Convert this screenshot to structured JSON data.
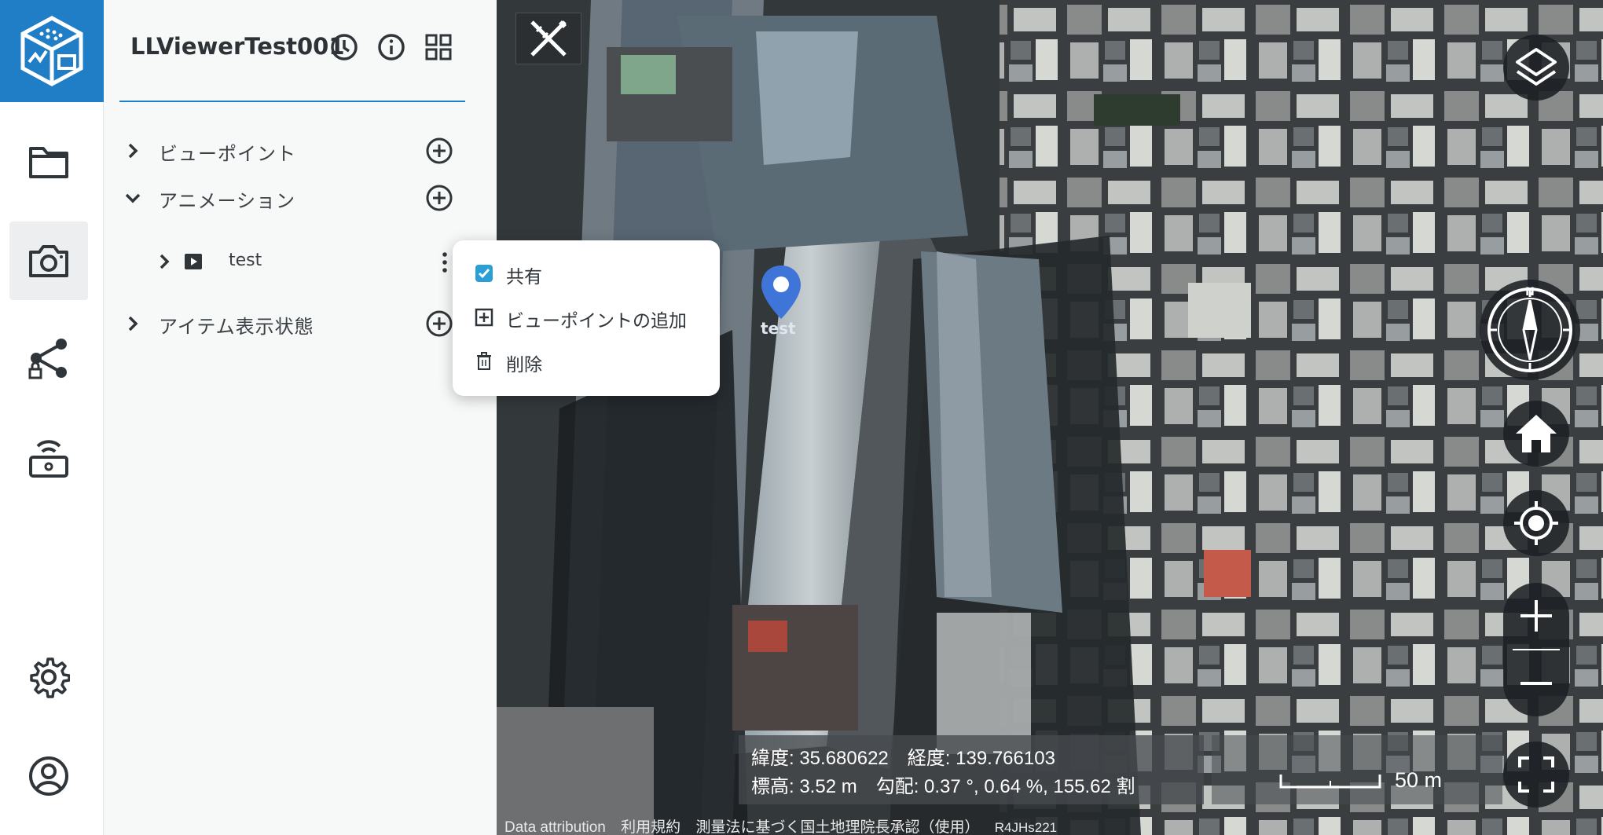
{
  "project": {
    "title": "LLViewerTest001"
  },
  "rail": {
    "items": [
      {
        "name": "folder",
        "icon": "folder-icon"
      },
      {
        "name": "camera",
        "icon": "camera-icon",
        "active": true
      },
      {
        "name": "share",
        "icon": "share-lock-icon"
      },
      {
        "name": "broadcast",
        "icon": "broadcast-icon"
      },
      {
        "name": "settings",
        "icon": "gear-icon"
      },
      {
        "name": "account",
        "icon": "user-circle-icon"
      }
    ]
  },
  "tree": {
    "sections": [
      {
        "label": "ビューポイント",
        "expanded": false
      },
      {
        "label": "アニメーション",
        "expanded": true
      },
      {
        "label": "アイテム表示状態",
        "expanded": false
      }
    ],
    "animation_items": [
      {
        "label": "test"
      }
    ]
  },
  "context_menu": {
    "share_label": "共有",
    "share_checked": true,
    "add_viewpoint_label": "ビューポイントの追加",
    "delete_label": "削除"
  },
  "map": {
    "pin_label": "test",
    "coords_line1": "緯度: 35.680622　経度: 139.766103",
    "coords_line2": "標高: 3.52 m　勾配: 0.37 °, 0.64 %, 155.62 割",
    "scale_label": "50 m",
    "attribution": {
      "data": "Data attribution",
      "terms": "利用規約",
      "survey": "測量法に基づく国土地理院長承認（使用）",
      "code": "R4JHs221"
    }
  },
  "colors": {
    "brand": "#1f7ec5",
    "pin": "#3f74d8",
    "checkbox": "#2a9fd6"
  }
}
